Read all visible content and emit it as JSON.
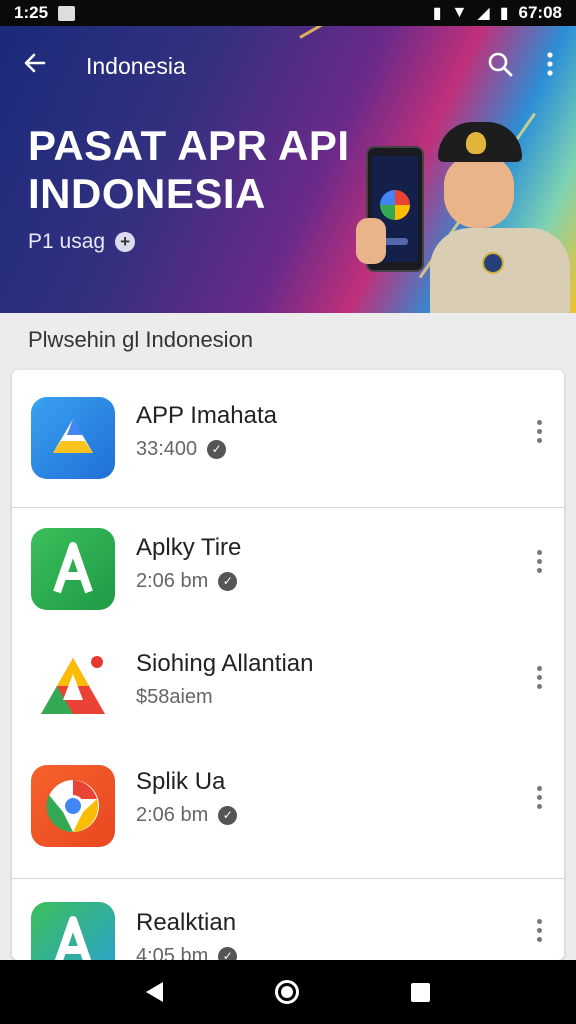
{
  "status_bar": {
    "time": "1:25",
    "battery_text": "67:08",
    "icons": [
      "notification-icon",
      "vibrate-icon",
      "wifi-icon",
      "signal-icon",
      "battery-icon"
    ]
  },
  "toolbar": {
    "title": "Indonesia",
    "back_icon": "arrow-left-icon",
    "search_icon": "search-icon",
    "more_icon": "more-vert-icon"
  },
  "hero": {
    "title_line1": "PASAT APR API",
    "title_line2": "INDONESIA",
    "subtitle": "P1 usag"
  },
  "section": {
    "label": "Plwsehin gl Indonesion"
  },
  "apps": [
    {
      "name": "APP Imahata",
      "meta": "33:400",
      "icon": "drive-style-app-icon"
    },
    {
      "name": "Aplky Tire",
      "meta": "2:06 bm",
      "icon": "green-a-app-icon"
    },
    {
      "name": "Siohing Allantian",
      "meta": "$58aiem",
      "icon": "colorful-play-app-icon"
    },
    {
      "name": "Splik Ua",
      "meta": "2:06 bm",
      "icon": "chrome-style-app-icon"
    },
    {
      "name": "Realktian",
      "meta": "4:05 bm",
      "icon": "green-blue-a-app-icon"
    }
  ],
  "colors": {
    "hero_start": "#1b2a7a",
    "hero_mid": "#c0307a",
    "hero_end": "#f2c12e",
    "list_bg": "#ffffff",
    "page_bg": "#ececec"
  }
}
